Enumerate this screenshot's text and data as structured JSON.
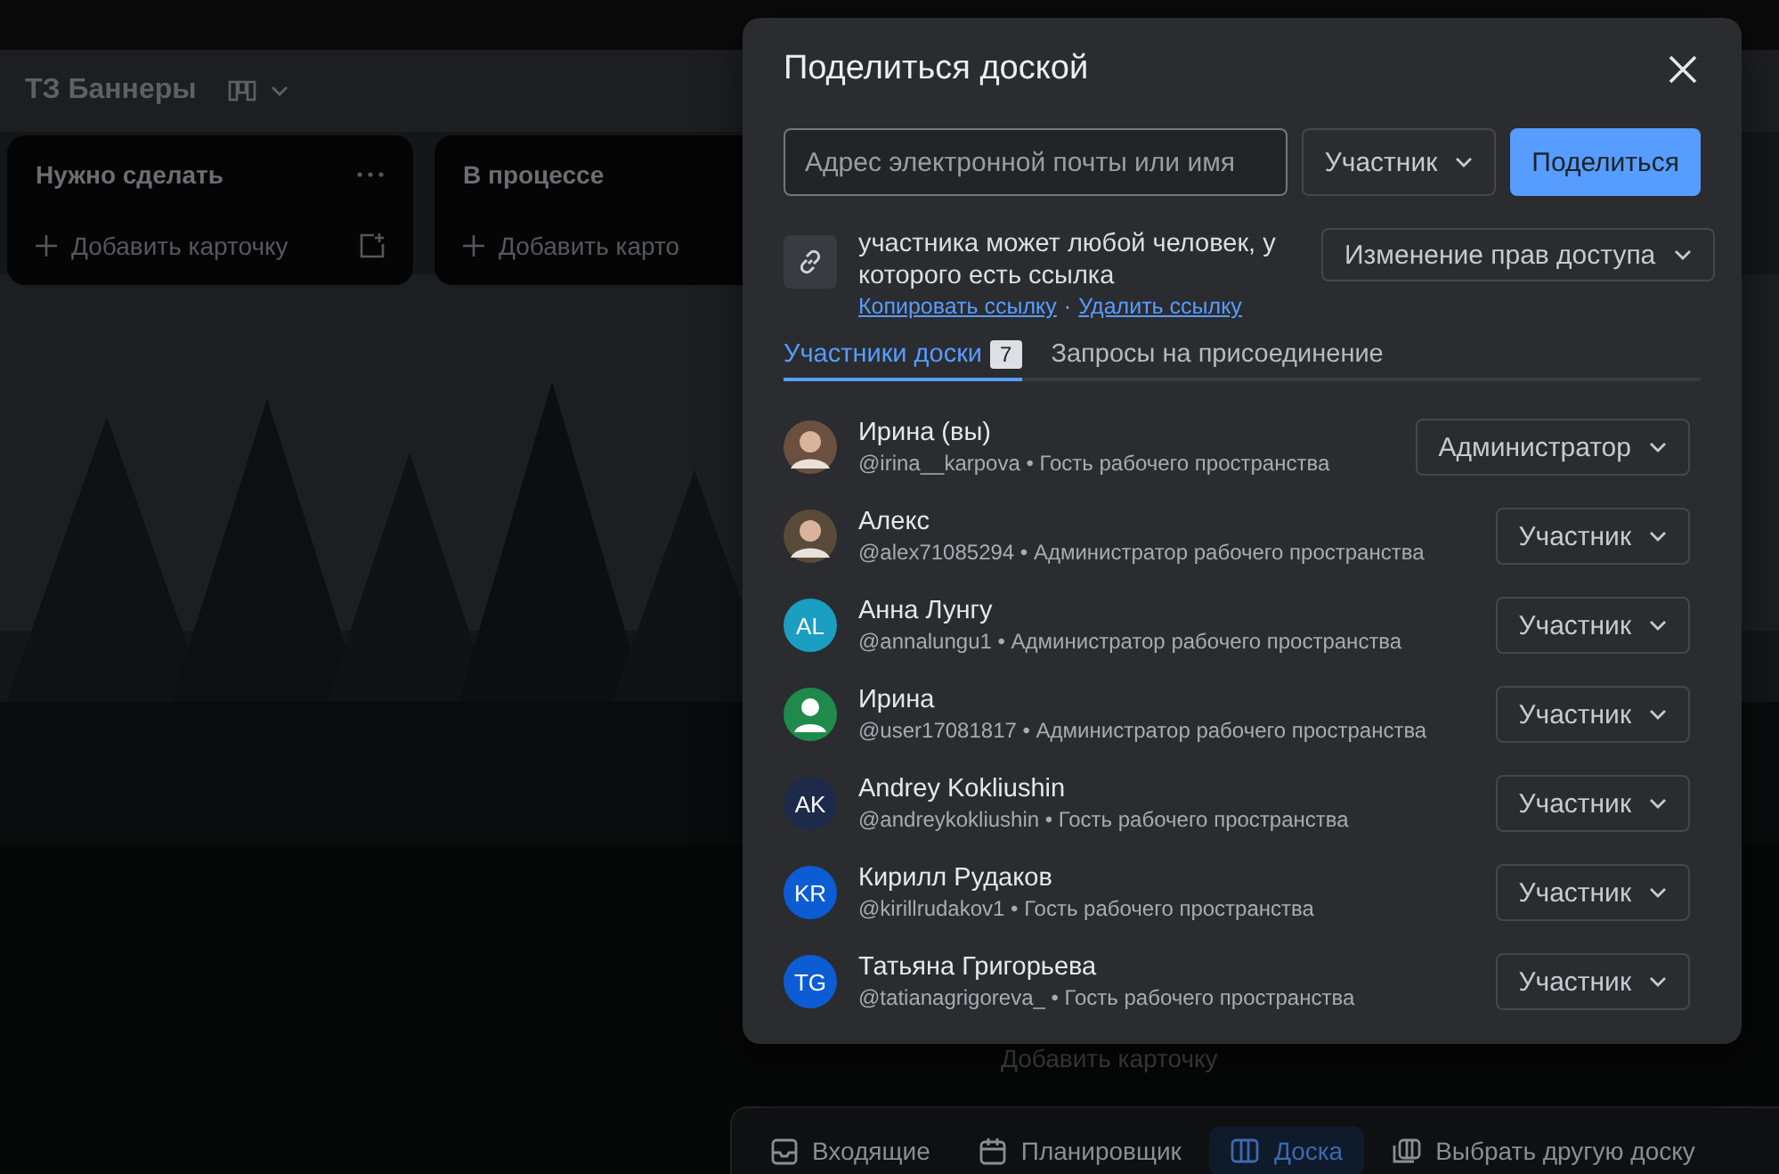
{
  "board": {
    "title": "ТЗ Баннеры",
    "lists": [
      {
        "title": "Нужно сделать",
        "add_label": "Добавить карточку",
        "has_menu": true
      },
      {
        "title": "В процессе",
        "add_label": "Добавить карто",
        "has_menu": false
      }
    ],
    "hidden_add_label": "Добавить карточку"
  },
  "share_dialog": {
    "title": "Поделиться доской",
    "email_field": {
      "placeholder": "Адрес электронной почты или имя"
    },
    "role_select": "Участник",
    "share_button": "Поделиться",
    "link_text": "участника может любой человек, у которого есть ссылка",
    "link_actions": [
      "Копировать ссылку",
      "Удалить ссылку"
    ],
    "link_separator": "·",
    "access_button": "Изменение прав доступа",
    "tabs": [
      {
        "label": "Участники доски",
        "count": "7",
        "selected": true
      },
      {
        "label": "Запросы на присоединение",
        "selected": false
      }
    ],
    "members": [
      {
        "name": "Ирина (вы)",
        "subtitle": "@irina__karpova • Гость рабочего пространства",
        "role": "Администратор"
      },
      {
        "name": "Алекс",
        "subtitle": "@alex71085294 • Администратор рабочего пространства",
        "role": "Участник"
      },
      {
        "name": "Анна Лунгу",
        "subtitle": "@annalungu1 • Администратор рабочего пространства",
        "role": "Участник",
        "avatar": {
          "kind": "initials",
          "initials": "AL",
          "color": "#1a9ec2"
        }
      },
      {
        "name": "Ирина",
        "subtitle": "@user17081817 • Администратор рабочего пространства",
        "role": "Участник",
        "avatar": {
          "kind": "silhouette",
          "color": "#1f8a4c"
        }
      },
      {
        "name": "Andrey Kokliushin",
        "subtitle": "@andreykokliushin • Гость рабочего пространства",
        "role": "Участник",
        "avatar": {
          "kind": "initials",
          "initials": "AK",
          "color": "#1e2a4a"
        }
      },
      {
        "name": "Кирилл Рудаков",
        "subtitle": "@kirillrudakov1 • Гость рабочего пространства",
        "role": "Участник",
        "avatar": {
          "kind": "initials",
          "initials": "KR",
          "color": "#0c5cd4"
        }
      },
      {
        "name": "Татьяна Григорьева",
        "subtitle": "@tatianagrigoreva_ • Гость рабочего пространства",
        "role": "Участник",
        "avatar": {
          "kind": "initials",
          "initials": "TG",
          "color": "#0c5cd4"
        }
      }
    ]
  },
  "bottom_nav": [
    {
      "label": "Входящие",
      "kind": "inbox",
      "selected": false
    },
    {
      "label": "Планировщик",
      "kind": "calendar",
      "selected": false
    },
    {
      "label": "Доска",
      "kind": "board",
      "selected": true
    },
    {
      "label": "Выбрать другую доску",
      "kind": "switch",
      "selected": false
    }
  ]
}
